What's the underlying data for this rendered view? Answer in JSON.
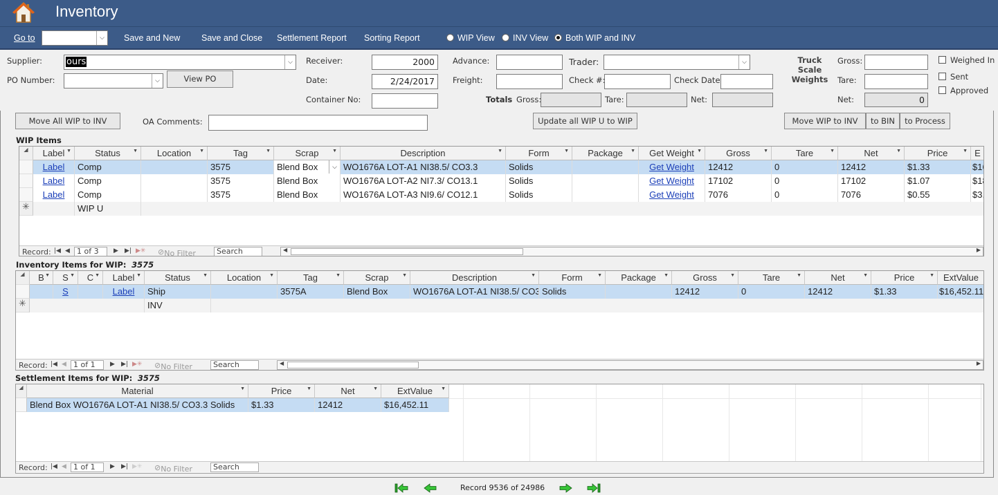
{
  "app": {
    "title": "Inventory"
  },
  "toolbar": {
    "goto_label": "Go to",
    "goto_value": "",
    "save_new": "Save and New",
    "save_close": "Save and Close",
    "settlement_report": "Settlement Report",
    "sorting_report": "Sorting Report",
    "view_options": [
      {
        "label": "WIP View",
        "selected": false
      },
      {
        "label": "INV View",
        "selected": false
      },
      {
        "label": "Both WIP and INV",
        "selected": true
      }
    ]
  },
  "header": {
    "supplier_label": "Supplier:",
    "supplier_value": "ours",
    "po_number_label": "PO Number:",
    "po_number_value": "",
    "view_po": "View PO",
    "receiver_label": "Receiver:",
    "receiver_value": "2000",
    "date_label": "Date:",
    "date_value": "2/24/2017",
    "container_label": "Container No:",
    "container_value": "",
    "advance_label": "Advance:",
    "advance_value": "",
    "freight_label": "Freight:",
    "freight_value": "",
    "trader_label": "Trader:",
    "trader_value": "",
    "check_no_label": "Check #:",
    "check_no_value": "",
    "check_date_label": "Check Date:",
    "check_date_value": "",
    "totals_label": "Totals",
    "totals_gross_label": "Gross:",
    "totals_gross_value": "",
    "totals_tare_label": "Tare:",
    "totals_tare_value": "",
    "totals_net_label": "Net:",
    "totals_net_value": "",
    "truck_scale_label_1": "Truck Scale",
    "truck_scale_label_2": "Weights",
    "ts_gross_label": "Gross:",
    "ts_gross_value": "",
    "ts_tare_label": "Tare:",
    "ts_tare_value": "",
    "ts_net_label": "Net:",
    "ts_net_value": "0",
    "weighed_in": "Weighed In",
    "sent": "Sent",
    "approved": "Approved"
  },
  "actions": {
    "move_all": "Move All WIP to INV",
    "oa_comments_label": "OA Comments:",
    "oa_comments_value": "",
    "update_all": "Update all WIP U to WIP",
    "move_wip_inv": "Move WIP to INV",
    "to_bin": "to BIN",
    "to_process": "to Process"
  },
  "wip": {
    "title": "WIP Items",
    "columns": [
      "Label",
      "Status",
      "Location",
      "Tag",
      "Scrap",
      "Description",
      "Form",
      "Package",
      "Get Weight",
      "Gross",
      "Tare",
      "Net",
      "Price",
      "E"
    ],
    "rows": [
      [
        "Label",
        "Comp",
        "",
        "3575",
        "Blend Box",
        "WO1676A LOT-A1 NI38.5/ CO3.3",
        "Solids",
        "",
        "Get Weight",
        "12412",
        "0",
        "12412",
        "$1.33",
        "$16"
      ],
      [
        "Label",
        "Comp",
        "",
        "3575",
        "Blend Box",
        "WO1676A LOT-A2 NI7.3/ CO13.1",
        "Solids",
        "",
        "Get Weight",
        "17102",
        "0",
        "17102",
        "$1.07",
        "$18"
      ],
      [
        "Label",
        "Comp",
        "",
        "3575",
        "Blend Box",
        "WO1676A LOT-A3 NI9.6/ CO12.1",
        "Solids",
        "",
        "Get Weight",
        "7076",
        "0",
        "7076",
        "$0.55",
        "$3,"
      ]
    ],
    "new_row_status": "WIP U",
    "nav": {
      "record_label": "Record:",
      "position": "1 of 3",
      "filter": "No Filter",
      "search": "Search"
    }
  },
  "inv": {
    "title": "Inventory Items for WIP:",
    "wip_no": "3575",
    "columns": [
      "B",
      "S",
      "C",
      "Label",
      "Status",
      "Location",
      "Tag",
      "Scrap",
      "Description",
      "Form",
      "Package",
      "Gross",
      "Tare",
      "Net",
      "Price",
      "ExtValue"
    ],
    "rows": [
      [
        "",
        "S",
        "",
        "Label",
        "Ship",
        "",
        "3575A",
        "Blend Box",
        "WO1676A LOT-A1 NI38.5/ CO3",
        "Solids",
        "",
        "12412",
        "0",
        "12412",
        "$1.33",
        "$16,452.11"
      ]
    ],
    "new_row_status": "INV",
    "nav": {
      "record_label": "Record:",
      "position": "1 of 1",
      "filter": "No Filter",
      "search": "Search"
    }
  },
  "settle": {
    "title": "Settlement Items for WIP:",
    "wip_no": "3575",
    "columns": [
      "Material",
      "Price",
      "Net",
      "ExtValue"
    ],
    "rows": [
      [
        "Blend Box WO1676A LOT-A1 NI38.5/ CO3.3 Solids",
        "$1.33",
        "12412",
        "$16,452.11"
      ]
    ],
    "nav": {
      "record_label": "Record:",
      "position": "1 of 1",
      "filter": "No Filter",
      "search": "Search"
    }
  },
  "footer": {
    "record_text": "Record 9536 of 24986"
  }
}
